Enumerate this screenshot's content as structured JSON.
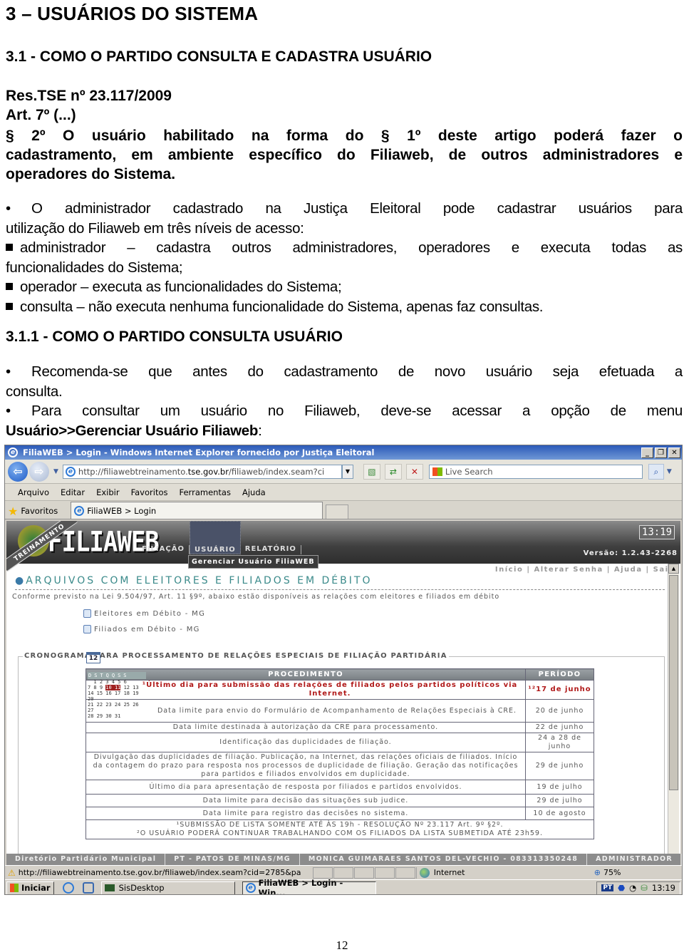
{
  "doc": {
    "h1": "3 – USUÁRIOS DO SISTEMA",
    "h2": "3.1 - COMO O PARTIDO CONSULTA E CADASTRA USUÁRIO",
    "res": "Res.TSE nº 23.117/2009",
    "art": "Art. 7º (...)",
    "par_lines": [
      "§ 2º O usuário habilitado na forma do § 1º deste artigo poderá fazer o",
      "cadastramento, em ambiente específico do Filiaweb, de outros administradores e",
      "operadores do Sistema."
    ],
    "bullet1_lines": [
      "O administrador cadastrado na Justiça Eleitoral pode cadastrar usuários para",
      "utilização do Filiaweb em três níveis de acesso:"
    ],
    "levels": [
      {
        "lines": [
          "administrador – cadastra outros administradores, operadores e executa todas as",
          "funcionalidades do Sistema;"
        ]
      },
      {
        "lines": [
          "operador – executa as funcionalidades do Sistema;"
        ]
      },
      {
        "lines": [
          "consulta – não executa nenhuma funcionalidade do Sistema, apenas faz consultas."
        ]
      }
    ],
    "h3": "3.1.1 - COMO O PARTIDO CONSULTA USUÁRIO",
    "bullet2_lines": [
      "Recomenda-se que antes do cadastramento de novo usuário seja efetuada a",
      "consulta."
    ],
    "bullet3_line": "Para consultar um usuário no Filiaweb, deve-se acessar a opção de menu",
    "bullet3_bold": "Usuário>>Gerenciar Usuário Filiaweb",
    "bullet3_tail": ":",
    "page_number": "12"
  },
  "browser": {
    "title": "FiliaWEB > Login - Windows Internet Explorer fornecido por Justiça Eleitoral",
    "url_prefix": "http://filiawebtreinamento.",
    "url_domain": "tse.gov.br",
    "url_suffix": "/filiaweb/index.seam?ci",
    "search_placeholder": "Live Search",
    "menu": [
      "Arquivo",
      "Editar",
      "Exibir",
      "Favoritos",
      "Ferramentas",
      "Ajuda"
    ],
    "favorites_label": "Favoritos",
    "tab_label": "FiliaWEB > Login",
    "status_url": "http://filiawebtreinamento.tse.gov.br/filiaweb/index.seam?cid=2785&pa",
    "zone": "Internet",
    "zoom": "75%"
  },
  "app": {
    "logo": "FILIAWEB",
    "ribbon": "TREINAMENTO",
    "nav": [
      "FILIAÇÃO",
      "USUÁRIO",
      "RELATÓRIO"
    ],
    "submenu": "Gerenciar Usuário FiliaWEB",
    "clock": "13:19",
    "version": "Versão: 1.2.43-2268",
    "toplinks": "Início | Alterar Senha | Ajuda | Sair",
    "section_title": "ARQUIVOS COM ELEITORES E FILIADOS EM DÉBITO",
    "conforme": "Conforme previsto na Lei 9.504/97, Art. 11 §9º, abaixo estão disponíveis as relações com eleitores e filiados em débito",
    "downloads": [
      "Eleitores em Débito - MG",
      "Filiados em Débito - MG"
    ],
    "crono_title": "CRONOGRAMA PARA PROCESSAMENTO DE RELAÇÕES ESPECIAIS DE FILIAÇÃO PARTIDÁRIA",
    "calendar_day": "12",
    "table": {
      "headers": [
        "PROCEDIMENTO",
        "PERÍODO"
      ],
      "rows": [
        {
          "proc": "¹Último dia para submissão das relações de filiados pelos partidos políticos via Internet.",
          "period": "¹²17 de junho"
        },
        {
          "proc": "Data limite para envio do Formulário de Acompanhamento de Relações Especiais à CRE.",
          "period": "20 de junho"
        },
        {
          "proc": "Data limite destinada à autorização da CRE para processamento.",
          "period": "22 de junho"
        },
        {
          "proc": "Identificação das duplicidades de filiação.",
          "period": "24 a 28 de junho"
        },
        {
          "proc": "Divulgação das duplicidades de filiação. Publicação, na Internet, das relações oficiais de filiados. Início da contagem do prazo para resposta nos processos de duplicidade de filiação. Geração das notificações para partidos e filiados envolvidos em duplicidade.",
          "period": "29 de junho"
        },
        {
          "proc": "Último dia para apresentação de resposta por filiados e partidos envolvidos.",
          "period": "19 de julho"
        },
        {
          "proc": "Data limite para decisão das situações sub judice.",
          "period": "29 de julho"
        },
        {
          "proc": "Data limite para registro das decisões no sistema.",
          "period": "10 de agosto"
        }
      ],
      "notes": [
        "¹SUBMISSÃO DE LISTA SOMENTE ATÉ ÀS 19h - RESOLUÇÃO Nº 23.117 Art. 9º §2º.",
        "²O USUÁRIO PODERÁ CONTINUAR TRABALHANDO COM OS FILIADOS DA LISTA SUBMETIDA ATÉ 23h59."
      ]
    },
    "footer": [
      "Diretório Partidário Municipal",
      "PT - PATOS DE MINAS/MG",
      "MONICA GUIMARAES SANTOS DEL-VECHIO - 08331335024​8",
      "ADMINISTRADOR"
    ]
  },
  "taskbar": {
    "start": "Iniciar",
    "tasks": [
      "SisDesktop",
      "FiliaWEB > Login - Win..."
    ],
    "tray_lang": "PT",
    "time": "13:19"
  }
}
